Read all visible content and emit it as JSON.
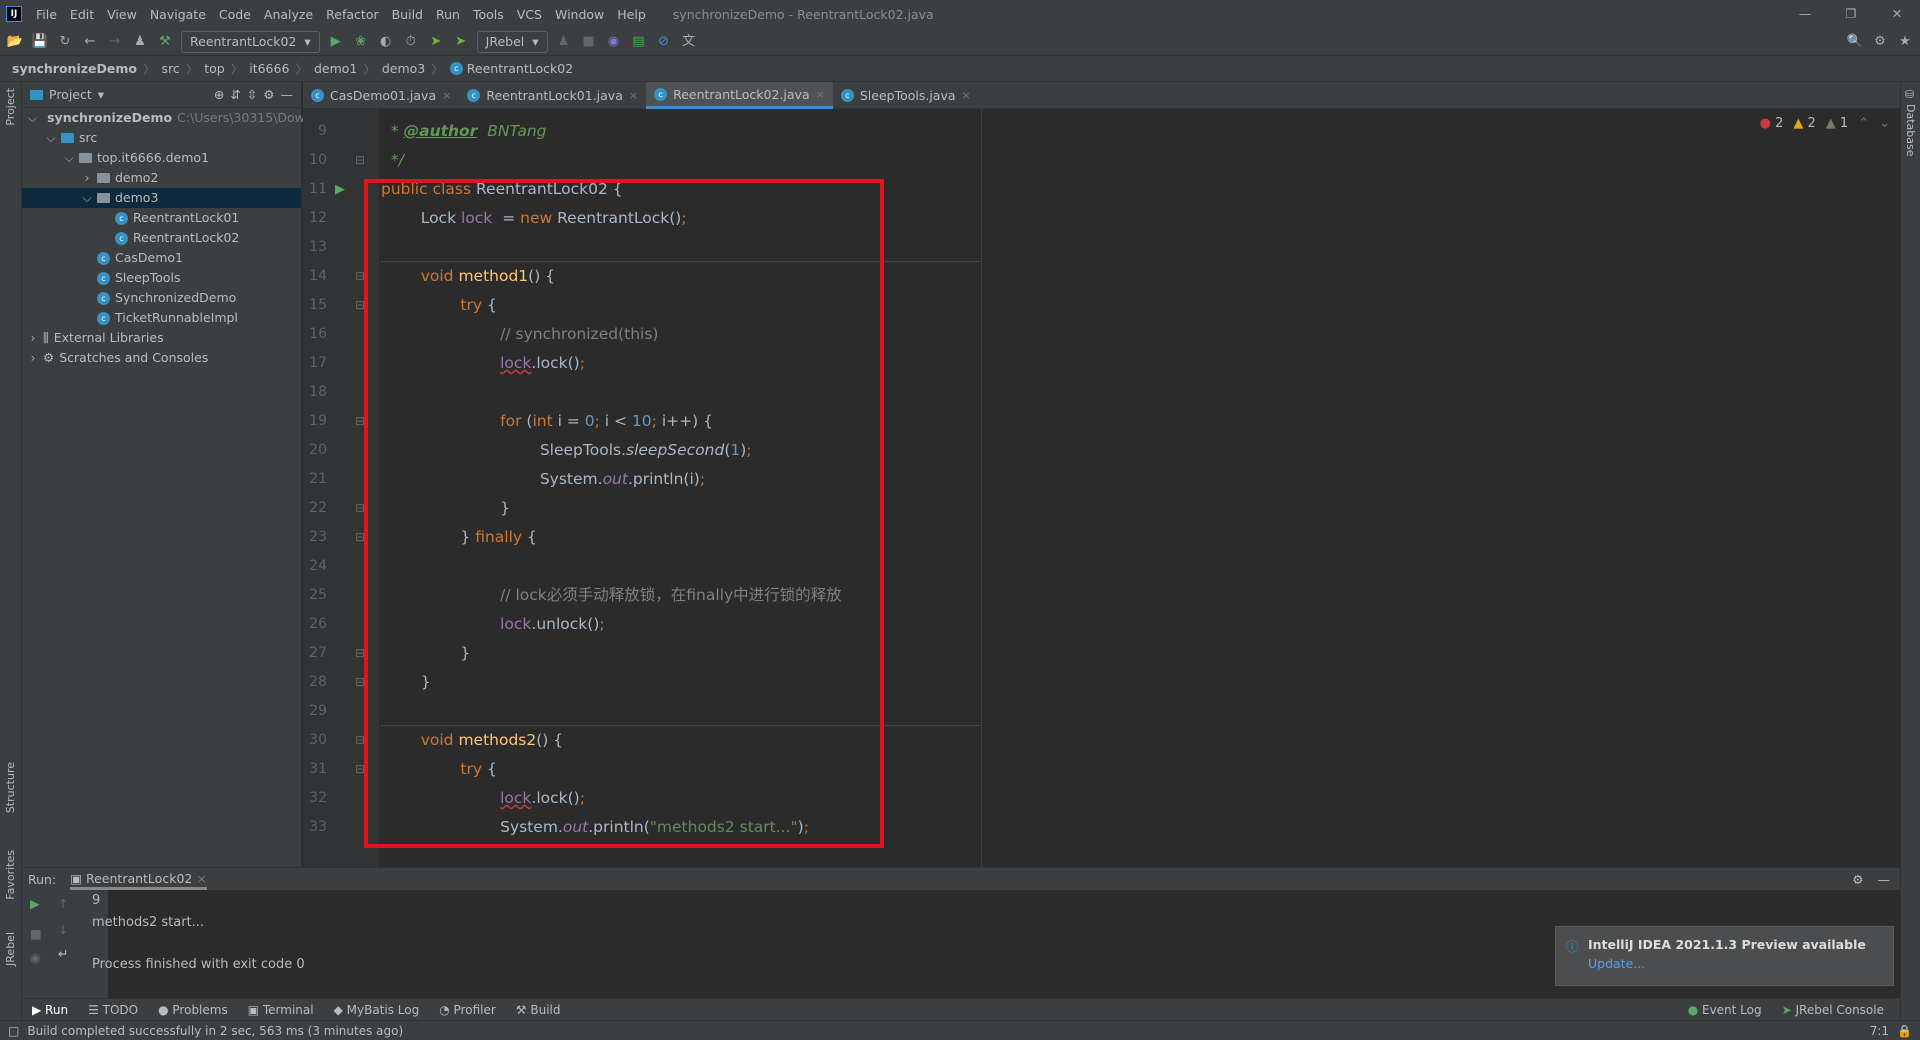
{
  "menubar": {
    "items": [
      "File",
      "Edit",
      "View",
      "Navigate",
      "Code",
      "Analyze",
      "Refactor",
      "Build",
      "Run",
      "Tools",
      "VCS",
      "Window",
      "Help"
    ],
    "title": "synchronizeDemo - ReentrantLock02.java",
    "logo": "IJ"
  },
  "toolbar": {
    "run_config": "ReentrantLock02",
    "jrebel": "JRebel"
  },
  "breadcrumb": [
    "synchronizeDemo",
    "src",
    "top",
    "it6666",
    "demo1",
    "demo3",
    "ReentrantLock02"
  ],
  "project": {
    "title": "Project",
    "tree": [
      {
        "label": "synchronizeDemo",
        "extra": "C:\\Users\\30315\\Dow",
        "level": 0,
        "open": true,
        "icon": "folder"
      },
      {
        "label": "src",
        "level": 1,
        "open": true,
        "icon": "folder-blue"
      },
      {
        "label": "top.it6666.demo1",
        "level": 2,
        "open": true,
        "icon": "folder"
      },
      {
        "label": "demo2",
        "level": 3,
        "open": false,
        "icon": "folder"
      },
      {
        "label": "demo3",
        "level": 3,
        "open": true,
        "icon": "folder",
        "selected": true
      },
      {
        "label": "ReentrantLock01",
        "level": 4,
        "icon": "class"
      },
      {
        "label": "ReentrantLock02",
        "level": 4,
        "icon": "class"
      },
      {
        "label": "CasDemo1",
        "level": 3,
        "icon": "class"
      },
      {
        "label": "SleepTools",
        "level": 3,
        "icon": "class"
      },
      {
        "label": "SynchronizedDemo",
        "level": 3,
        "icon": "class"
      },
      {
        "label": "TicketRunnableImpl",
        "level": 3,
        "icon": "class"
      },
      {
        "label": "External Libraries",
        "level": 0,
        "open": false,
        "icon": "library"
      },
      {
        "label": "Scratches and Consoles",
        "level": 0,
        "open": false,
        "icon": "scratch"
      }
    ]
  },
  "tabs": [
    {
      "label": "CasDemo01.java"
    },
    {
      "label": "ReentrantLock01.java"
    },
    {
      "label": "ReentrantLock02.java",
      "active": true
    },
    {
      "label": "SleepTools.java"
    }
  ],
  "inspections": {
    "errors": "2",
    "warnings": "2",
    "weak": "1"
  },
  "code": [
    {
      "n": "9",
      "t": [
        [
          " * ",
          "doc"
        ],
        [
          "@author",
          "tag"
        ],
        [
          " BNTang",
          "doc"
        ]
      ]
    },
    {
      "n": "10",
      "t": [
        [
          " */",
          "doc"
        ]
      ]
    },
    {
      "n": "11",
      "t": [
        [
          "public class ",
          "kw"
        ],
        [
          "ReentrantLock02 {",
          ""
        ]
      ]
    },
    {
      "n": "12",
      "t": [
        [
          "    Lock ",
          ""
        ],
        [
          "lock",
          "fld"
        ],
        [
          " = ",
          ""
        ],
        [
          "new ",
          "kw"
        ],
        [
          "ReentrantLock()",
          ""
        ],
        [
          ";",
          "kw"
        ]
      ]
    },
    {
      "n": "13",
      "t": []
    },
    {
      "n": "14",
      "t": [
        [
          "    void ",
          "kw"
        ],
        [
          "method1",
          "fn"
        ],
        [
          "() {",
          ""
        ]
      ]
    },
    {
      "n": "15",
      "t": [
        [
          "        try ",
          "kw"
        ],
        [
          "{",
          ""
        ]
      ]
    },
    {
      "n": "16",
      "t": [
        [
          "            // synchronized(this)",
          "cm"
        ]
      ]
    },
    {
      "n": "17",
      "t": [
        [
          "            ",
          ""
        ],
        [
          "lock",
          "fld ul"
        ],
        [
          ".lock()",
          ""
        ],
        [
          ";",
          "kw"
        ]
      ]
    },
    {
      "n": "18",
      "t": []
    },
    {
      "n": "19",
      "t": [
        [
          "            for ",
          "kw"
        ],
        [
          "(",
          ""
        ],
        [
          "int ",
          "kw"
        ],
        [
          "i = ",
          ""
        ],
        [
          "0",
          "num"
        ],
        [
          "; ",
          "kw"
        ],
        [
          "i < ",
          ""
        ],
        [
          "10",
          "num"
        ],
        [
          "; ",
          "kw"
        ],
        [
          "i++) {",
          ""
        ]
      ]
    },
    {
      "n": "20",
      "t": [
        [
          "                SleepTools.",
          ""
        ],
        [
          "sleepSecond",
          "it"
        ],
        [
          "(",
          ""
        ],
        [
          "1",
          "num"
        ],
        [
          ")",
          ""
        ],
        [
          ";",
          "kw"
        ]
      ]
    },
    {
      "n": "21",
      "t": [
        [
          "                System.",
          ""
        ],
        [
          "out",
          "sfi"
        ],
        [
          ".println(i)",
          ""
        ],
        [
          ";",
          "kw"
        ]
      ]
    },
    {
      "n": "22",
      "t": [
        [
          "            }",
          ""
        ]
      ]
    },
    {
      "n": "23",
      "t": [
        [
          "        } ",
          ""
        ],
        [
          "finally ",
          "kw"
        ],
        [
          "{",
          ""
        ]
      ]
    },
    {
      "n": "24",
      "t": []
    },
    {
      "n": "25",
      "t": [
        [
          "            // lock必须手动释放锁，在finally中进行锁的释放",
          "cm"
        ]
      ]
    },
    {
      "n": "26",
      "t": [
        [
          "            ",
          ""
        ],
        [
          "lock",
          "fld"
        ],
        [
          ".unlock()",
          ""
        ],
        [
          ";",
          "kw"
        ]
      ]
    },
    {
      "n": "27",
      "t": [
        [
          "        }",
          ""
        ]
      ]
    },
    {
      "n": "28",
      "t": [
        [
          "    }",
          ""
        ]
      ]
    },
    {
      "n": "29",
      "t": []
    },
    {
      "n": "30",
      "t": [
        [
          "    void ",
          "kw"
        ],
        [
          "methods2",
          "fn"
        ],
        [
          "() {",
          ""
        ]
      ]
    },
    {
      "n": "31",
      "t": [
        [
          "        try ",
          "kw"
        ],
        [
          "{",
          ""
        ]
      ]
    },
    {
      "n": "32",
      "t": [
        [
          "            ",
          ""
        ],
        [
          "lock",
          "fld ul"
        ],
        [
          ".lock()",
          ""
        ],
        [
          ";",
          "kw"
        ]
      ]
    },
    {
      "n": "33",
      "t": [
        [
          "            System.",
          ""
        ],
        [
          "out",
          "sfi"
        ],
        [
          ".println(",
          ""
        ],
        [
          "\"methods2 start...\"",
          "str"
        ],
        [
          ")",
          ""
        ],
        [
          ";",
          "kw"
        ]
      ]
    }
  ],
  "run": {
    "label": "Run:",
    "tab": "ReentrantLock02",
    "output": [
      "9",
      "methods2 start...",
      "",
      "Process finished with exit code 0"
    ]
  },
  "toolwindows": [
    "Run",
    "TODO",
    "Problems",
    "Terminal",
    "MyBatis Log",
    "Profiler",
    "Build"
  ],
  "toolwindows_right": [
    "Event Log",
    "JRebel Console"
  ],
  "stripes": {
    "left": [
      "Project",
      "Structure",
      "Favorites",
      "JRebel"
    ],
    "right": [
      "Database"
    ]
  },
  "status": {
    "text": "Build completed successfully in 2 sec, 563 ms (3 minutes ago)",
    "pos": "7:1"
  },
  "notification": {
    "title": "IntelliJ IDEA 2021.1.3 Preview available",
    "link": "Update..."
  },
  "colors": {
    "accent": "#4a88c7",
    "highlight_box": "#e0141e"
  }
}
